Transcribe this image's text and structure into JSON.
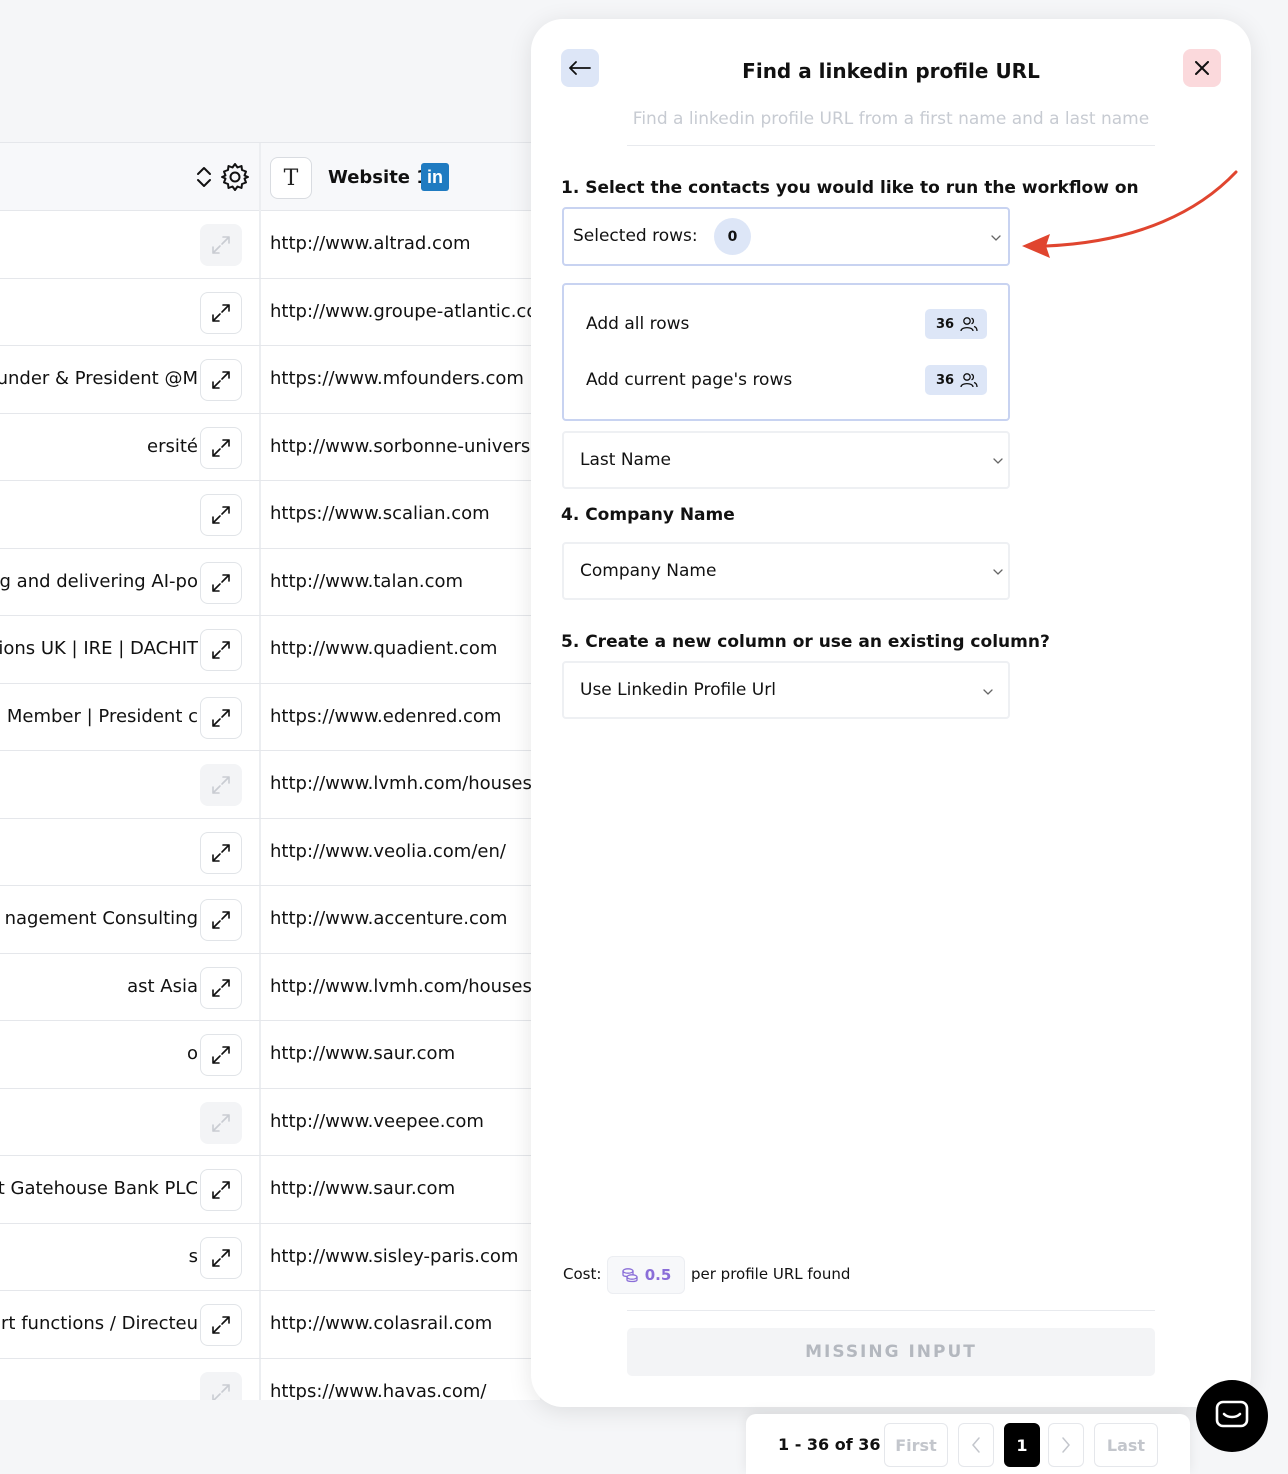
{
  "table": {
    "column_title": "Website 1",
    "type_badge": "T",
    "linkedin_logo": "in",
    "rows": [
      {
        "left": "",
        "url": "http://www.altrad.com",
        "dim": true
      },
      {
        "left": "",
        "url": "http://www.groupe-atlantic.com",
        "dim": false
      },
      {
        "left": "ounder & President @M",
        "url": "https://www.mfounders.com",
        "dim": false
      },
      {
        "left": "ersité",
        "url": "http://www.sorbonne-universite.fr",
        "dim": false
      },
      {
        "left": "",
        "url": "https://www.scalian.com",
        "dim": false
      },
      {
        "left": "g and delivering AI-po",
        "url": "http://www.talan.com",
        "dim": false
      },
      {
        "left": "tions UK | IRE | DACHIT",
        "url": "http://www.quadient.com",
        "dim": false
      },
      {
        "left": "d Member | President c",
        "url": "https://www.edenred.com",
        "dim": false
      },
      {
        "left": "",
        "url": "http://www.lvmh.com/houses",
        "dim": true
      },
      {
        "left": "",
        "url": "http://www.veolia.com/en/",
        "dim": false
      },
      {
        "left": "nagement Consulting",
        "url": "http://www.accenture.com",
        "dim": false
      },
      {
        "left": "ast Asia",
        "url": "http://www.lvmh.com/houses",
        "dim": false
      },
      {
        "left": "o",
        "url": "http://www.saur.com",
        "dim": false
      },
      {
        "left": "",
        "url": "http://www.veepee.com",
        "dim": true
      },
      {
        "left": "t Gatehouse Bank PLC",
        "url": "http://www.saur.com",
        "dim": false
      },
      {
        "left": "s",
        "url": "http://www.sisley-paris.com",
        "dim": false
      },
      {
        "left": "ort functions / Directeu",
        "url": "http://www.colasrail.com",
        "dim": false
      },
      {
        "left": "",
        "url": "https://www.havas.com/",
        "dim": true
      }
    ]
  },
  "panel": {
    "title": "Find a linkedin profile URL",
    "subtitle": "Find a linkedin profile URL from a first name and a last name",
    "step1_label": "1. Select the contacts you would like to run the workflow on",
    "selected_rows_label": "Selected rows:",
    "selected_rows_count": "0",
    "dropdown": {
      "add_all_label": "Add all rows",
      "add_all_count": "36",
      "add_page_label": "Add current page's rows",
      "add_page_count": "36"
    },
    "last_name_value": "Last Name",
    "step4_label": "4. Company Name",
    "company_value": "Company Name",
    "step5_label": "5. Create a new column or use an existing column?",
    "column_value": "Use Linkedin Profile Url",
    "cost_label": "Cost:",
    "cost_value": "0.5",
    "cost_suffix": "per profile URL found",
    "submit_label": "MISSING INPUT"
  },
  "pagination": {
    "range": "1 - 36 of 36",
    "first": "First",
    "current_page": "1",
    "last": "Last"
  },
  "colors": {
    "accent_light": "#dde6f7",
    "close_bg": "#fbd9dc",
    "arrow": "#e0452f",
    "linkedin": "#1f7bc1"
  }
}
